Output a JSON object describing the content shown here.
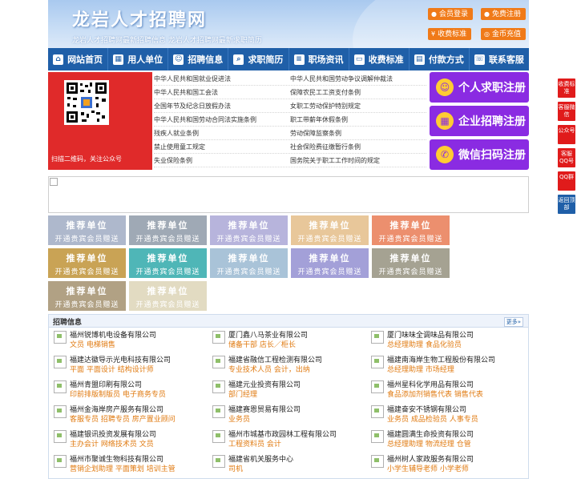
{
  "header": {
    "title": "龙岩人才招聘网",
    "subtitle": "龙岩人才招聘网最新招聘信息    龙岩人才招聘网最新求职简历",
    "buttons": [
      "会员登录",
      "免费注册",
      "收费标准",
      "金币充值"
    ]
  },
  "nav": [
    "网站首页",
    "用人单位",
    "招聘信息",
    "求职简历",
    "职场资讯",
    "收费标准",
    "付款方式",
    "联系客服"
  ],
  "qr": {
    "caption": "扫描二维码，关注公众号"
  },
  "laws": [
    [
      "中华人民共和国就业促进法",
      "中华人民共和国劳动争议调解仲裁法"
    ],
    [
      "中华人民共和国工会法",
      "保障农民工工资支付条例"
    ],
    [
      "全国年节及纪念日放假办法",
      "女职工劳动保护特别规定"
    ],
    [
      "中华人民共和国劳动合同法实施条例",
      "职工带薪年休假条例"
    ],
    [
      "残疾人就业条例",
      "劳动保障监察条例"
    ],
    [
      "禁止使用童工规定",
      "社会保险费征缴暂行条例"
    ],
    [
      "失业保险条例",
      "国务院关于职工工作时间的规定"
    ]
  ],
  "register": [
    "个人求职注册",
    "企业招聘注册",
    "微信扫码注册"
  ],
  "recommend": {
    "title": "推荐单位",
    "subtitle": "开通贵宾会员赠送",
    "colors": [
      "#aeb8cc",
      "#9fa9b5",
      "#b7b4dc",
      "#e8c79a",
      "#ec8f6e",
      "#c9a355",
      "#4fb6b7",
      "#a9c3d8",
      "#a3a0d8",
      "#a5a292",
      "#b1a184",
      "#e2dbc2"
    ]
  },
  "jobs": {
    "title": "招聘信息",
    "more": "更多»",
    "items": [
      {
        "company": "福州锐博机电设备有限公司",
        "positions": "文员 电梯销售"
      },
      {
        "company": "厦门鑫八马茶业有限公司",
        "positions": "储备干部 店长／柜长"
      },
      {
        "company": "厦门味味全调味品有限公司",
        "positions": "总经理助理 食品化验员"
      },
      {
        "company": "福建达徽导示光电科技有限公司",
        "positions": "平面 平面设计 结构设计师"
      },
      {
        "company": "福建省融信工程检测有限公司",
        "positions": "专业技术人员 会计，出纳"
      },
      {
        "company": "福建南海岸生物工程股份有限公司",
        "positions": "总经理助理 市场经理"
      },
      {
        "company": "福州青盟印刷有限公司",
        "positions": "印前排版制版员 电子商务专员"
      },
      {
        "company": "福建元业投资有限公司",
        "positions": "部门经理"
      },
      {
        "company": "福州星科化学用品有限公司",
        "positions": "食品添加剂销售代表 销售代表"
      },
      {
        "company": "福州金海岸房产服务有限公司",
        "positions": "客服专员 招聘专员 房产置业顾问"
      },
      {
        "company": "福建赛恩贸易有限公司",
        "positions": "业务员"
      },
      {
        "company": "福建奋安不锈钢有限公司",
        "positions": "业务员 成品检验员 人事专员"
      },
      {
        "company": "福建银讯投资发展有限公司",
        "positions": "主办会计 网络技术员 文员"
      },
      {
        "company": "福州市城基市政园林工程有限公司",
        "positions": "工程资料员 会计"
      },
      {
        "company": "福建圆满生命投资有限公司",
        "positions": "总经理助理 物流经理 仓管"
      },
      {
        "company": "福州市聚诚生物科技有限公司",
        "positions": "营销企划助理 平面策划 培训主管"
      },
      {
        "company": "福建省机关服务中心",
        "positions": "司机"
      },
      {
        "company": "福州树人家政服务有限公司",
        "positions": "小学生辅导老师 小学老师"
      }
    ]
  },
  "float": [
    "收费标准",
    "客服微信",
    "公众号",
    "客服QQ号",
    "QQ群",
    "返回顶部"
  ]
}
